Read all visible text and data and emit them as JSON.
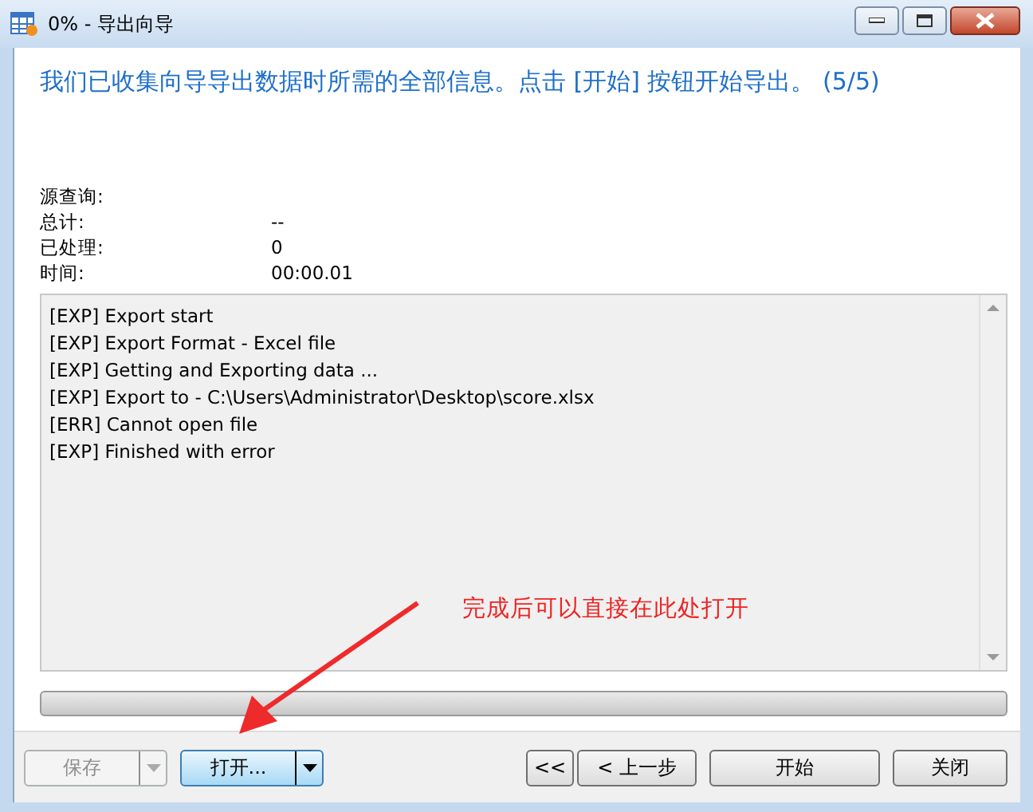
{
  "window": {
    "title": "0% - 导出向导"
  },
  "heading": "我们已收集向导导出数据时所需的全部信息。点击 [开始] 按钮开始导出。 (5/5)",
  "info": [
    {
      "label": "源查询:"
    },
    {
      "label": "总计:",
      "value": "--"
    },
    {
      "label": "已处理:",
      "value": "0"
    },
    {
      "label": "时间:",
      "value": "00:00.01"
    }
  ],
  "log": [
    "[EXP] Export start",
    "[EXP] Export Format - Excel file",
    "[EXP] Getting and Exporting data ...",
    "[EXP] Export to - C:\\Users\\Administrator\\Desktop\\score.xlsx",
    "[ERR] Cannot open file",
    "[EXP] Finished with error"
  ],
  "progress": {
    "level": 0
  },
  "buttons": [
    {
      "label": "保存",
      "kind": "split",
      "disabled": true,
      "highlighted": false
    },
    {
      "label": "打开...",
      "kind": "split",
      "disabled": false,
      "highlighted": true
    },
    {
      "label": "<<",
      "kind": "plain",
      "disabled": false,
      "highlighted": false
    },
    {
      "label": "< 上一步",
      "kind": "plain",
      "disabled": false,
      "highlighted": false
    },
    {
      "label": "开始",
      "kind": "plain",
      "disabled": false,
      "highlighted": false
    },
    {
      "label": "关闭",
      "kind": "plain",
      "disabled": false,
      "highlighted": false
    }
  ],
  "annotation": {
    "text": "完成后可以直接在此处打开"
  }
}
